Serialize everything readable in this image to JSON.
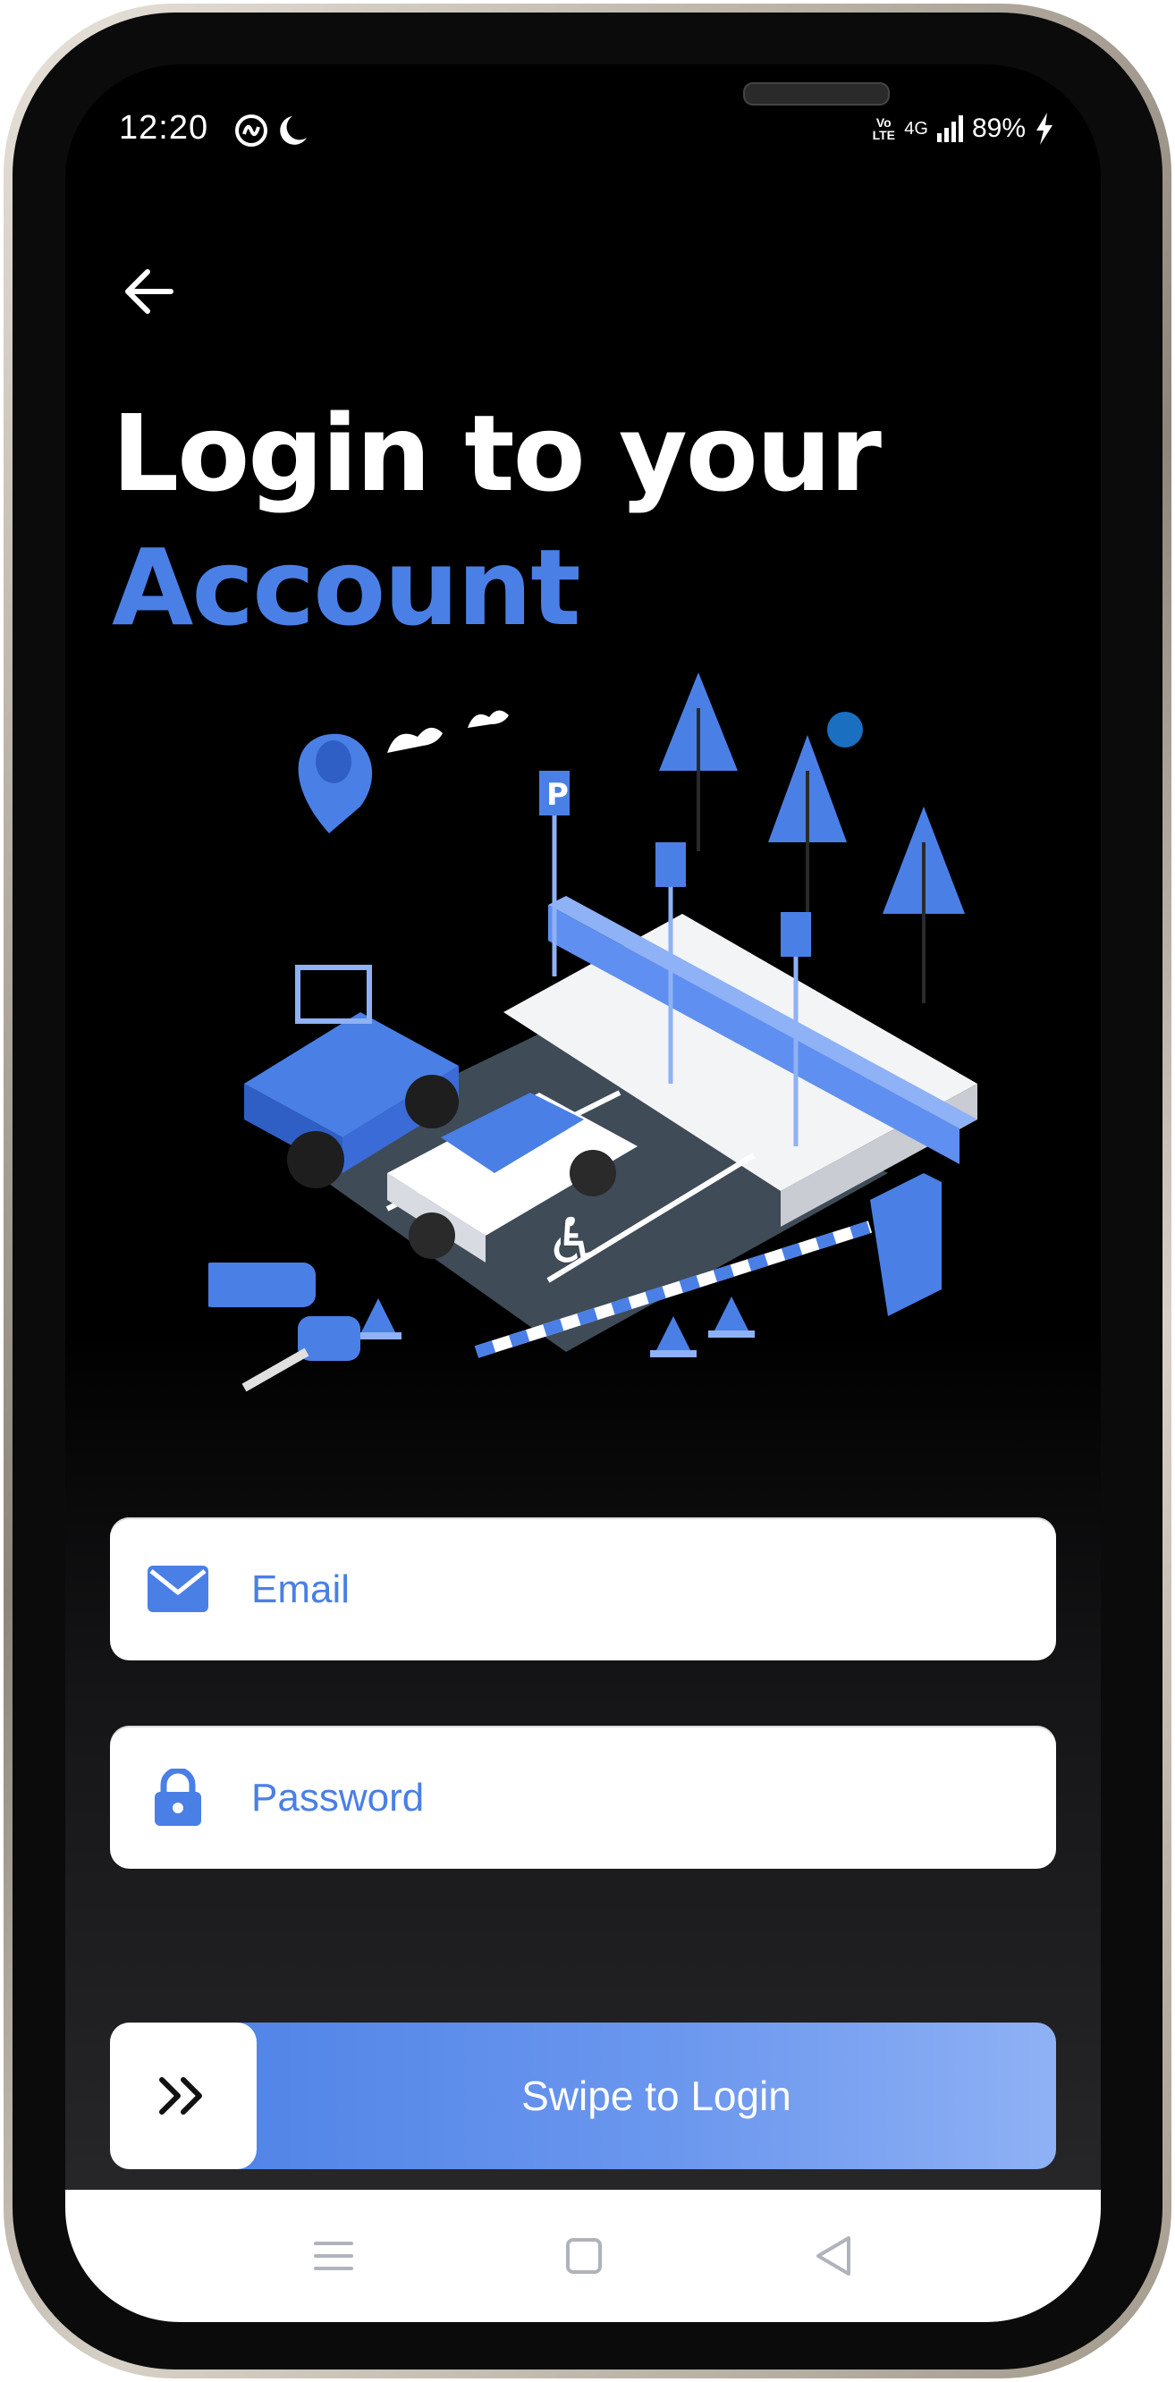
{
  "status_bar": {
    "time": "12:20",
    "network": "4G",
    "volte": "Vo LTE",
    "battery": "89%"
  },
  "header": {
    "back_icon": "arrow-left-icon",
    "title_line1": "Login to your",
    "title_line2": "Account"
  },
  "illustration": {
    "icon": "parking-lot-illustration"
  },
  "form": {
    "email": {
      "icon": "mail-icon",
      "placeholder": "Email",
      "value": ""
    },
    "password": {
      "icon": "lock-icon",
      "placeholder": "Password",
      "value": ""
    }
  },
  "swipe": {
    "icon": "double-chevron-right-icon",
    "label": "Swipe to Login"
  },
  "nav": {
    "menu_icon": "menu-icon",
    "home_icon": "square-home-icon",
    "back_icon": "triangle-back-icon"
  },
  "colors": {
    "accent": "#4a7fe6",
    "background": "#000000",
    "field": "#ffffff"
  }
}
